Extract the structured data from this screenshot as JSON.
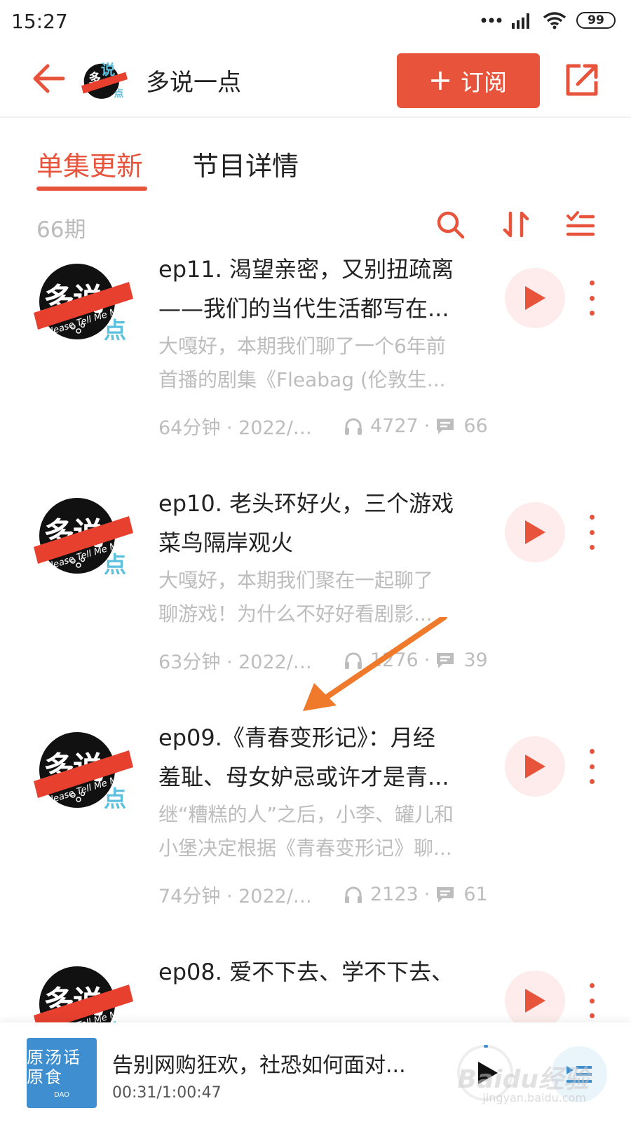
{
  "status_bar": {
    "time": "15:27",
    "battery": "99"
  },
  "header": {
    "title": "多说一点",
    "subscribe_label": "订阅",
    "subscribe_icon": "plus-icon"
  },
  "tabs": [
    {
      "label": "单集更新",
      "active": true
    },
    {
      "label": "节目详情",
      "active": false
    }
  ],
  "toolbar": {
    "episode_count": "66期",
    "icons": [
      "search-icon",
      "sort-icon",
      "filter-list-icon"
    ]
  },
  "cover": {
    "big_text": "多说",
    "small_char": "点",
    "banner_text": "Please Tell Me More"
  },
  "episodes": [
    {
      "title_line1": "ep11. 渴望亲密，又别扭疏离",
      "title_line2": "——我们的当代生活都写在...",
      "desc_line1": "大嘎好，本期我们聊了一个6年前",
      "desc_line2": "首播的剧集《Fleabag (伦敦生...",
      "duration_date": "64分钟 · 2022/0...",
      "plays": "4727",
      "comments": "66"
    },
    {
      "title_line1": "ep10. 老头环好火，三个游戏",
      "title_line2": "菜鸟隔岸观火",
      "desc_line1": "大嘎好，本期我们聚在一起聊了",
      "desc_line2": "聊游戏！为什么不好好看剧影...",
      "duration_date": "63分钟 · 2022/0...",
      "plays": "1276",
      "comments": "39"
    },
    {
      "title_line1": "ep09.《青春变形记》：月经",
      "title_line2": "羞耻、母女妒忌或许才是青...",
      "desc_line1": "继“糟糕的人”之后，小李、罐儿和",
      "desc_line2": "小堡决定根据《青春变形记》聊...",
      "duration_date": "74分钟 · 2022/0...",
      "plays": "2123",
      "comments": "61"
    },
    {
      "title_line1": "ep08. 爱不下去、学不下去、",
      "title_line2": ""
    }
  ],
  "mini_player": {
    "cover_text": "原汤话原食",
    "cover_sub": "DAO",
    "title": "告别网购狂欢，社恐如何面对...",
    "time": "00:31/1:00:47",
    "progress": 0.009
  },
  "watermark": {
    "text": "Baidu经验",
    "sub": "jingyan.baidu.com"
  },
  "colors": {
    "accent": "#e8533b",
    "muted": "#bdbdbd"
  }
}
